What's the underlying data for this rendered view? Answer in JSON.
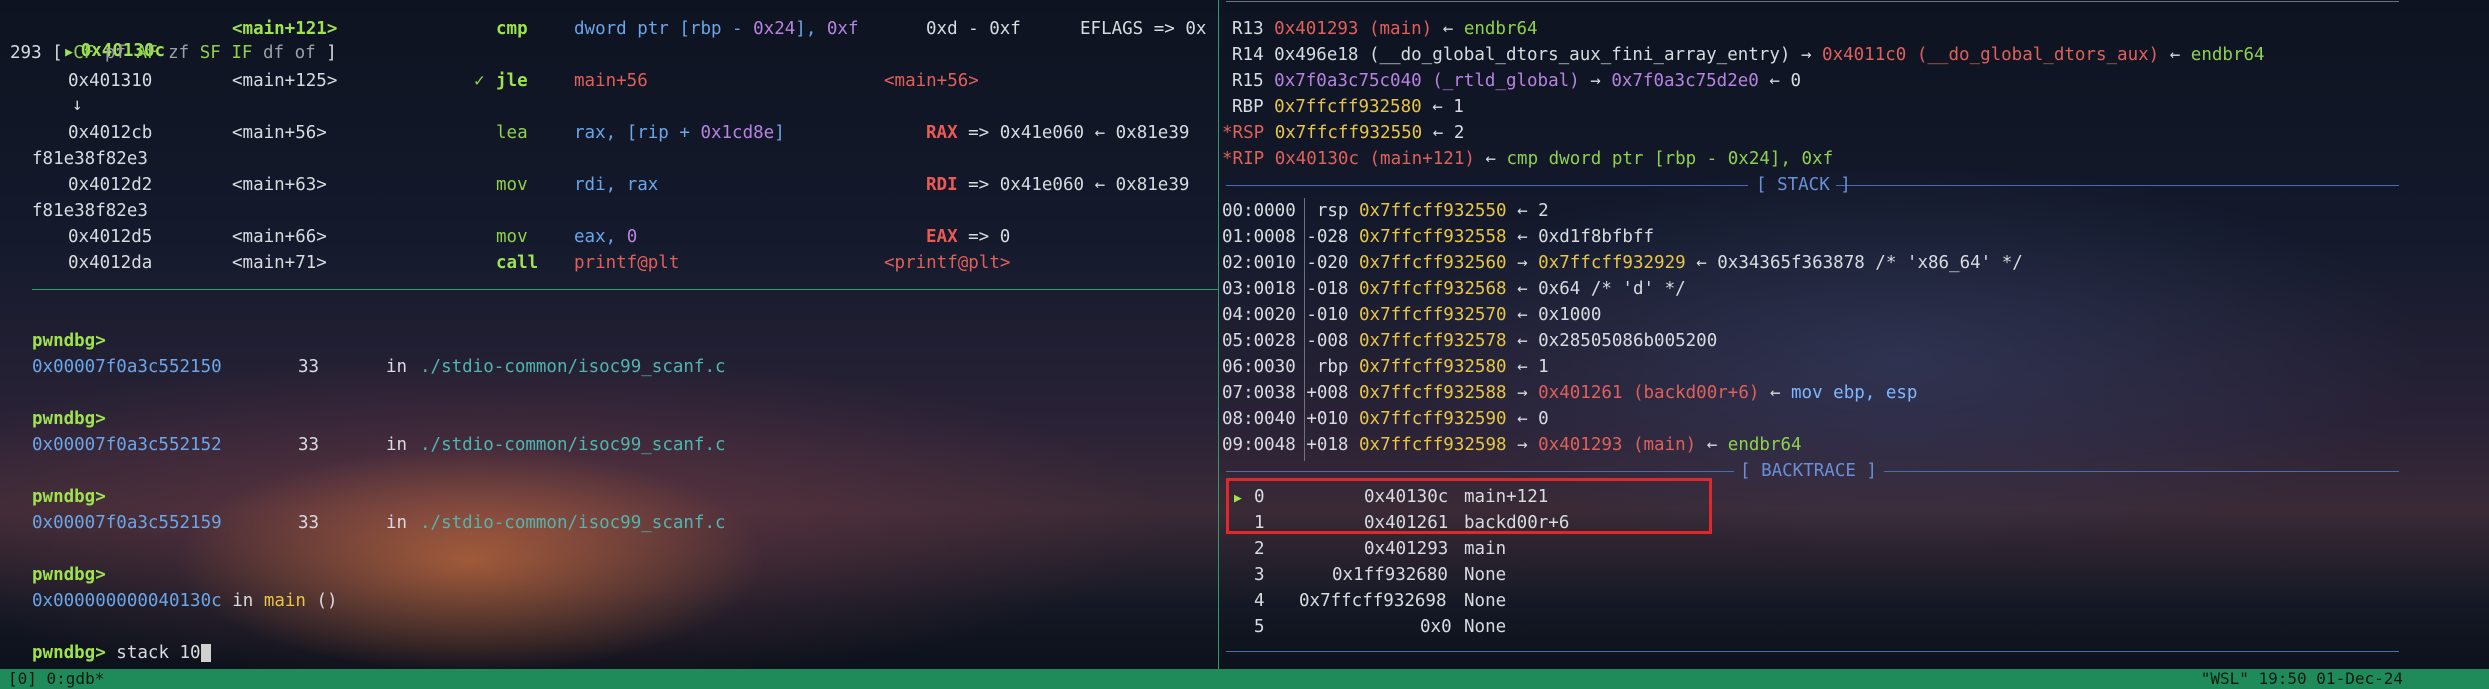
{
  "disasm": {
    "cur_addr": "0x40130c",
    "cur_sym": "<main+121>",
    "cur_mnem": "cmp",
    "cur_op_a": "dword ptr [",
    "cur_op_reg": "rbp",
    "cur_op_b": " - ",
    "cur_op_imm": "0x24",
    "cur_op_c": "], ",
    "cur_op_imm2": "0xf",
    "cur_comment": "0xd - 0xf",
    "cur_flags": "EFLAGS => 0x",
    "flags_line_a": "293 [ ",
    "flags_cf": "CF",
    "flags_pf": "pf",
    "flags_af": "AF",
    "flags_zf": "zf",
    "flags_sf": "SF",
    "flags_if": "IF",
    "flags_df": "df",
    "flags_of": "of",
    "flags_line_b": " ]",
    "rows": [
      {
        "addr": "0x401310",
        "sym": "<main+125>",
        "check": "✓",
        "mnem": "jle",
        "op": "main+56",
        "cmt": "<main+56>"
      },
      {
        "addr": "0x4012cb",
        "sym": "<main+56>",
        "mnem": "lea",
        "op_reg": "rax",
        "op_rest": ", [rip + ",
        "op_imm": "0x1cd8e",
        "op_end": "]",
        "cmt_reg": "RAX",
        "cmt_rest": " => 0x41e060 ← 0x81e39",
        "wrap": "f81e38f82e3"
      },
      {
        "addr": "0x4012d2",
        "sym": "<main+63>",
        "mnem": "mov",
        "op_reg": "rdi",
        "op_rest": ", ",
        "op_reg2": "rax",
        "cmt_reg": "RDI",
        "cmt_rest": " => 0x41e060 ← 0x81e39",
        "wrap": "f81e38f82e3"
      },
      {
        "addr": "0x4012d5",
        "sym": "<main+66>",
        "mnem": "mov",
        "op_reg": "eax",
        "op_rest": ", ",
        "op_imm": "0",
        "cmt_reg": "EAX",
        "cmt_rest": " => 0"
      },
      {
        "addr": "0x4012da",
        "sym": "<main+71>",
        "mnem": "call",
        "op": "printf@plt",
        "cmt": "<printf@plt>"
      }
    ],
    "down_arrow": "↓"
  },
  "console": {
    "prompt": "pwndbg>",
    "frames": [
      {
        "addr": "0x00007f0a3c552150",
        "line": "33",
        "in": "in",
        "file": "./stdio-common/isoc99_scanf.c"
      },
      {
        "addr": "0x00007f0a3c552152",
        "line": "33",
        "in": "in",
        "file": "./stdio-common/isoc99_scanf.c"
      },
      {
        "addr": "0x00007f0a3c552159",
        "line": "33",
        "in": "in",
        "file": "./stdio-common/isoc99_scanf.c"
      }
    ],
    "last_addr": "0x000000000040130c",
    "last_in": " in ",
    "last_fn": "main",
    "last_parens": " ()",
    "command": " stack 10"
  },
  "regs": [
    {
      "name": "R13",
      "val": "0x401293 (main)",
      "arrow": " ← ",
      "tail": "endbr64",
      "tail_color": "gr",
      "val_color": "rd"
    },
    {
      "name": "R14",
      "val": "0x496e18 (__do_global_dtors_aux_fini_array_entry)",
      "arrow": " → ",
      "val2": "0x4011c0 (__do_global_dtors_aux)",
      "arrow2": " ← ",
      "tail": "endbr64",
      "val_color": "wh"
    },
    {
      "name": "R15",
      "val": "0x7f0a3c75c040 (_rtld_global)",
      "arrow": " → ",
      "val2": "0x7f0a3c75d2e0",
      "arrow2": " ← ",
      "tail": "0",
      "val_color": "pu"
    },
    {
      "name": "RBP",
      "val": "0x7ffcff932580",
      "arrow": " ← ",
      "tail": "1",
      "val_color": "ye"
    },
    {
      "name": "*RSP",
      "val": "0x7ffcff932550",
      "arrow": " ← ",
      "tail": "2",
      "val_color": "ye"
    },
    {
      "name": "*RIP",
      "val": "0x40130c (main+121)",
      "arrow": " ← ",
      "tail": "cmp dword ptr [rbp - 0x24], 0xf",
      "val_color": "rd"
    }
  ],
  "stack": {
    "title": "[ STACK ]",
    "rows": [
      {
        "idx": "00:0000",
        "off": " rsp",
        "addr": "0x7ffcff932550",
        "arrow": " ← ",
        "val": "2"
      },
      {
        "idx": "01:0008",
        "off": "-028",
        "addr": "0x7ffcff932558",
        "arrow": " ← ",
        "val": "0xd1f8bfbff"
      },
      {
        "idx": "02:0010",
        "off": "-020",
        "addr": "0x7ffcff932560",
        "arrow": " → ",
        "val2": "0x7ffcff932929",
        "arrow2": " ← ",
        "val": "0x34365f363878 /* 'x86_64' */"
      },
      {
        "idx": "03:0018",
        "off": "-018",
        "addr": "0x7ffcff932568",
        "arrow": " ← ",
        "val": "0x64 /* 'd' */"
      },
      {
        "idx": "04:0020",
        "off": "-010",
        "addr": "0x7ffcff932570",
        "arrow": " ← ",
        "val": "0x1000"
      },
      {
        "idx": "05:0028",
        "off": "-008",
        "addr": "0x7ffcff932578",
        "arrow": " ← ",
        "val": "0x28505086b005200"
      },
      {
        "idx": "06:0030",
        "off": " rbp",
        "addr": "0x7ffcff932580",
        "arrow": " ← ",
        "val": "1"
      },
      {
        "idx": "07:0038",
        "off": "+008",
        "addr": "0x7ffcff932588",
        "arrow": " → ",
        "val3": "0x401261 (backd00r+6)",
        "arrow2": " ← ",
        "val": "mov ebp, esp"
      },
      {
        "idx": "08:0040",
        "off": "+010",
        "addr": "0x7ffcff932590",
        "arrow": " ← ",
        "val": "0"
      },
      {
        "idx": "09:0048",
        "off": "+018",
        "addr": "0x7ffcff932598",
        "arrow": " → ",
        "val3": "0x401293 (main)",
        "arrow2": " ← ",
        "val": "endbr64"
      }
    ]
  },
  "backtrace": {
    "title": "[ BACKTRACE ]",
    "rows": [
      {
        "mark": "▶",
        "n": "0",
        "addr": "0x40130c",
        "sym": "main+121"
      },
      {
        "mark": "",
        "n": "1",
        "addr": "0x401261",
        "sym": "backd00r+6"
      },
      {
        "mark": "",
        "n": "2",
        "addr": "0x401293",
        "sym": "main"
      },
      {
        "mark": "",
        "n": "3",
        "addr": "0x1ff932680",
        "sym": "None"
      },
      {
        "mark": "",
        "n": "4",
        "addr": "0x7ffcff932698",
        "sym": "None"
      },
      {
        "mark": "",
        "n": "5",
        "addr": "0x0",
        "sym": "None"
      }
    ]
  },
  "status": {
    "left": "[0] 0:gdb*",
    "right": "\"WSL\" 19:50 01-Dec-24"
  },
  "colors": {
    "statusbar": "#1f8a5a",
    "highlight_box": "#e0282a",
    "divider": "#2f9a6a"
  }
}
